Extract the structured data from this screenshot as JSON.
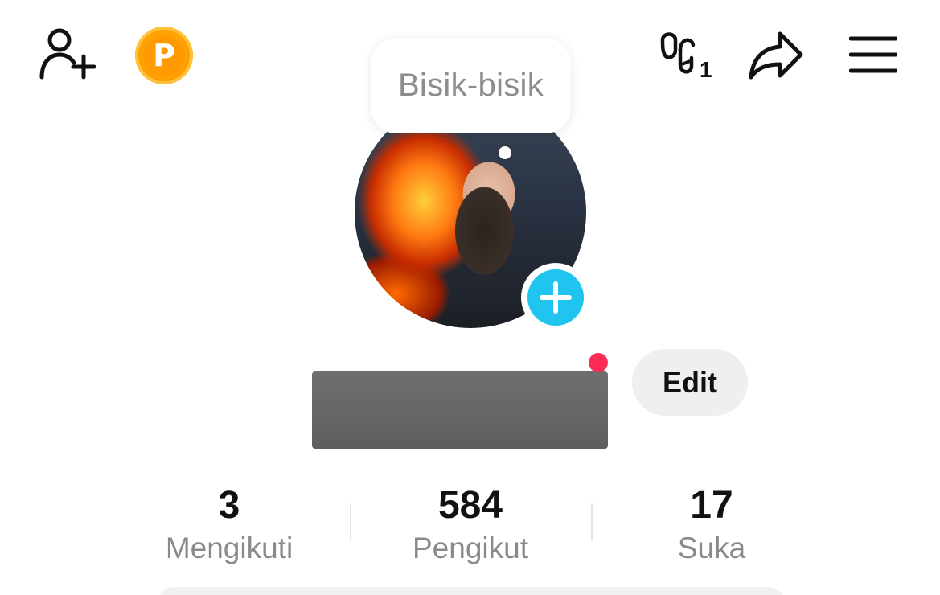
{
  "header": {
    "coin_label": "P",
    "visitors_count": "1"
  },
  "bubble": {
    "text": "Bisik-bisik"
  },
  "profile": {
    "edit_label": "Edit",
    "notification_dot_color": "#fe2c55",
    "add_story_color": "#20c5ef"
  },
  "stats": [
    {
      "value": "3",
      "label": "Mengikuti"
    },
    {
      "value": "584",
      "label": "Pengikut"
    },
    {
      "value": "17",
      "label": "Suka"
    }
  ]
}
